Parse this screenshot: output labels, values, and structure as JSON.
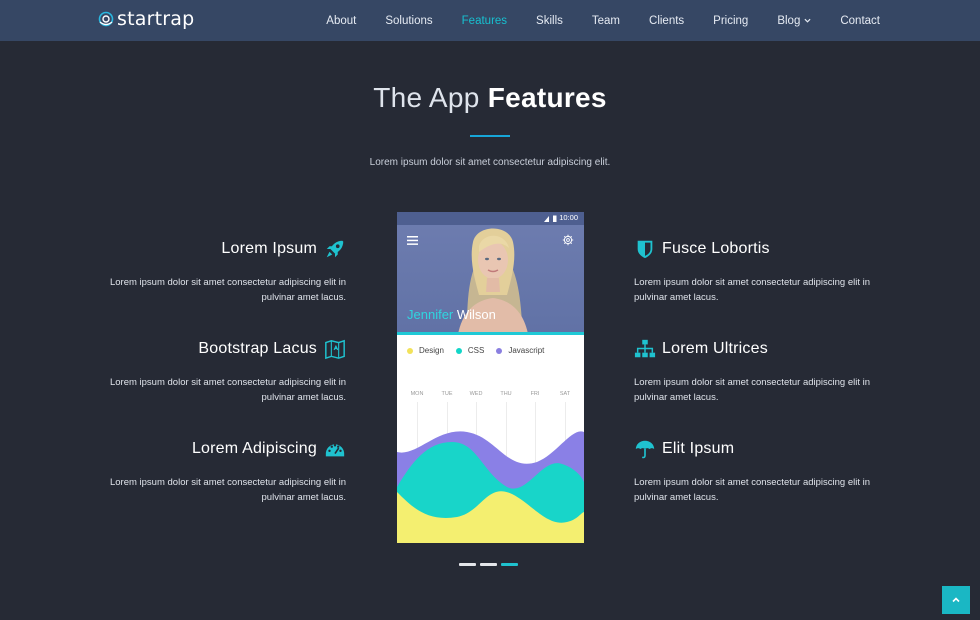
{
  "brand": {
    "name": "startrap",
    "accent": "#17c0d0",
    "nav_bg": "#364764",
    "page_bg": "#262a35"
  },
  "nav": {
    "items": [
      {
        "label": "About"
      },
      {
        "label": "Solutions"
      },
      {
        "label": "Features",
        "active": true
      },
      {
        "label": "Skills"
      },
      {
        "label": "Team"
      },
      {
        "label": "Clients"
      },
      {
        "label": "Pricing"
      },
      {
        "label": "Blog",
        "has_dropdown": true
      },
      {
        "label": "Contact"
      }
    ]
  },
  "section": {
    "title_light": "The App",
    "title_bold": "Features",
    "subtitle": "Lorem ipsum dolor sit amet consectetur adipiscing elit."
  },
  "features_left": [
    {
      "title": "Lorem Ipsum",
      "icon": "rocket-icon",
      "desc": "Lorem ipsum dolor sit amet consectetur adipiscing elit in pulvinar amet lacus."
    },
    {
      "title": "Bootstrap Lacus",
      "icon": "map-icon",
      "desc": "Lorem ipsum dolor sit amet consectetur adipiscing elit in pulvinar amet lacus."
    },
    {
      "title": "Lorem Adipiscing",
      "icon": "dashboard-icon",
      "desc": "Lorem ipsum dolor sit amet consectetur adipiscing elit in pulvinar amet lacus."
    }
  ],
  "features_right": [
    {
      "title": "Fusce Lobortis",
      "icon": "shield-icon",
      "desc": "Lorem ipsum dolor sit amet consectetur adipiscing elit in pulvinar amet lacus."
    },
    {
      "title": "Lorem Ultrices",
      "icon": "sitemap-icon",
      "desc": "Lorem ipsum dolor sit amet consectetur adipiscing elit in pulvinar amet lacus."
    },
    {
      "title": "Elit Ipsum",
      "icon": "umbrella-icon",
      "desc": "Lorem ipsum dolor sit amet consectetur adipiscing elit in pulvinar amet lacus."
    }
  ],
  "phone": {
    "time": "10:00",
    "first_name": "Jennifer",
    "last_name": "Wilson",
    "legend": [
      {
        "label": "Design",
        "color": "#f2e25a"
      },
      {
        "label": "CSS",
        "color": "#12d6c8"
      },
      {
        "label": "Javascript",
        "color": "#8a7fe0"
      }
    ],
    "days": [
      "MON",
      "TUE",
      "WED",
      "THU",
      "FRI",
      "SAT"
    ]
  },
  "carousel": {
    "count": 3,
    "active_index": 2
  }
}
